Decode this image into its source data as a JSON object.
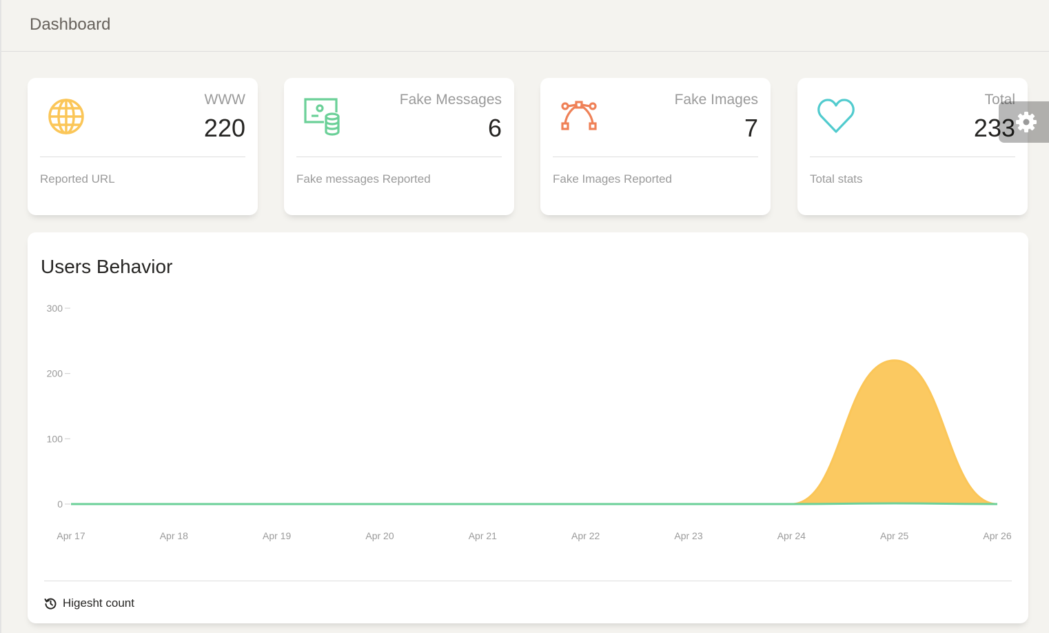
{
  "header": {
    "title": "Dashboard"
  },
  "stats": [
    {
      "category": "WWW",
      "value": "220",
      "footer": "Reported URL",
      "icon": "globe-icon",
      "color": "#fbc658"
    },
    {
      "category": "Fake Messages",
      "value": "6",
      "footer": "Fake messages Reported",
      "icon": "money-coins-icon",
      "color": "#6bd098"
    },
    {
      "category": "Fake Images",
      "value": "7",
      "footer": "Fake Images Reported",
      "icon": "vector-icon",
      "color": "#ef8157"
    },
    {
      "category": "Total",
      "value": "233",
      "footer": "Total stats",
      "icon": "heart-icon",
      "color": "#51cbce"
    }
  ],
  "settings": {
    "icon": "gear-icon"
  },
  "chart": {
    "title": "Users Behavior",
    "footer_label": "Higesht count",
    "footer_icon": "history-icon"
  },
  "chart_data": {
    "type": "area",
    "title": "Users Behavior",
    "categories": [
      "Apr 17",
      "Apr 18",
      "Apr 19",
      "Apr 20",
      "Apr 21",
      "Apr 22",
      "Apr 23",
      "Apr 24",
      "Apr 25",
      "Apr 26"
    ],
    "yticks": [
      0,
      100,
      200,
      300
    ],
    "ylim": [
      0,
      300
    ],
    "grid": false,
    "series": [
      {
        "values": [
          0,
          0,
          0,
          0,
          0,
          0,
          0,
          0,
          220,
          0
        ],
        "color": "#fbc658"
      },
      {
        "values": [
          0,
          0,
          0,
          0,
          0,
          0,
          0,
          0,
          1,
          0
        ],
        "color": "#6bd098"
      }
    ]
  }
}
